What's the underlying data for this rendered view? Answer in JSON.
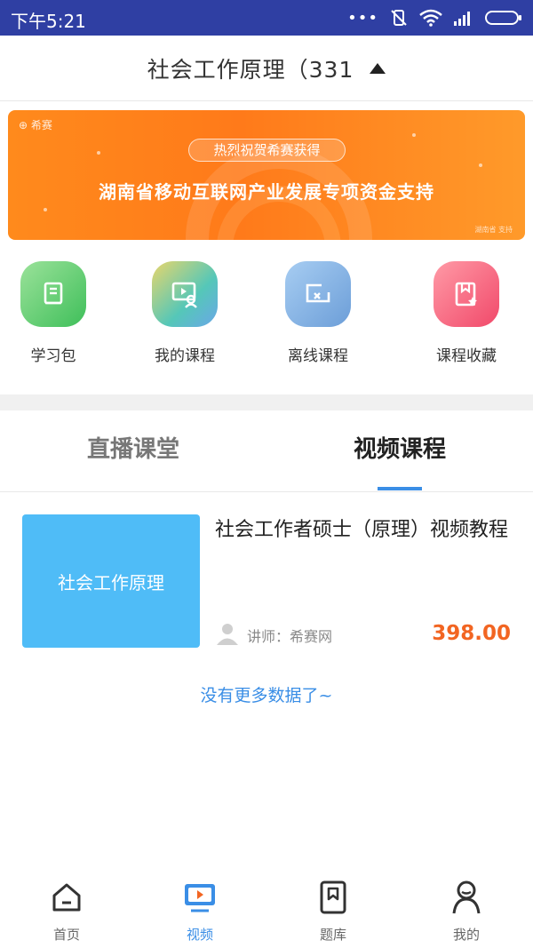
{
  "status_bar": {
    "time": "下午5:21",
    "dots": "•••"
  },
  "header": {
    "title": "社会工作原理（331"
  },
  "banner": {
    "brand": "希赛",
    "pill": "热烈祝贺希赛获得",
    "main": "湖南省移动互联网产业发展专项资金支持",
    "note": "湖南省 支持"
  },
  "quick_menu": [
    {
      "label": "学习包",
      "icon": "book-icon"
    },
    {
      "label": "我的课程",
      "icon": "course-video-icon"
    },
    {
      "label": "离线课程",
      "icon": "offline-icon"
    },
    {
      "label": "课程收藏",
      "icon": "favorite-icon"
    }
  ],
  "tabs": [
    {
      "label": "直播课堂",
      "active": false
    },
    {
      "label": "视频课程",
      "active": true
    }
  ],
  "course": {
    "thumb_text": "社会工作原理",
    "title": "社会工作者硕士（原理）视频教程",
    "teacher": "讲师：希赛网",
    "price": "398.00"
  },
  "no_more_text": "没有更多数据了~",
  "bottom_nav": [
    {
      "label": "首页",
      "icon": "home-icon",
      "active": false
    },
    {
      "label": "视频",
      "icon": "video-icon",
      "active": true
    },
    {
      "label": "题库",
      "icon": "question-bank-icon",
      "active": false
    },
    {
      "label": "我的",
      "icon": "profile-icon",
      "active": false
    }
  ],
  "colors": {
    "status_bar": "#2f3fa3",
    "accent": "#3a8ee6",
    "price": "#f26522",
    "banner": "#ff8a1c",
    "thumb": "#4fbcf7"
  }
}
